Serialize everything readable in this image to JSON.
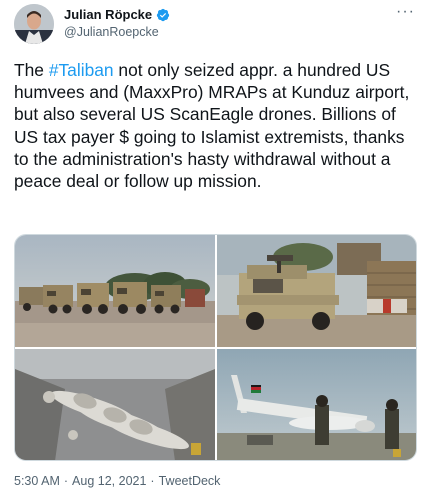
{
  "author": {
    "display_name": "Julian Röpcke",
    "handle": "@JulianRoepcke",
    "verified_icon": "verified-badge-icon"
  },
  "more_label": "···",
  "tweet": {
    "hashtag": "#Taliban",
    "text_before": "The ",
    "text_after": " not only seized appr. a hundred US humvees and (MaxxPro) MRAPs at Kunduz airport, but also several US ScanEagle drones. Billions of US tax payer $ going to Islamist extremists, thanks to the administration's hasty withdrawal without a peace deal or follow up mission."
  },
  "meta": {
    "time": "5:30 AM",
    "separator": "·",
    "date": "Aug 12, 2021",
    "source": "TweetDeck"
  },
  "colors": {
    "link": "#1d9bf0",
    "secondary_text": "#536471",
    "border": "#cfd9de"
  }
}
